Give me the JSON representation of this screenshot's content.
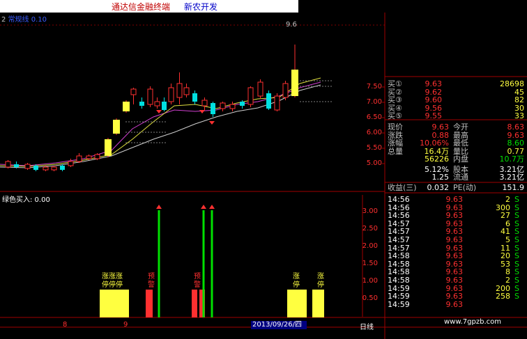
{
  "window": {
    "app_title": "通达信金融终端",
    "stock_name": "新农开发"
  },
  "price_chart": {
    "panel_index": "2",
    "indicator_name": "常规线",
    "indicator_value": "0.10",
    "high_marker": "9.6",
    "axis_ticks": [
      "7.50",
      "7.00",
      "6.50",
      "6.00",
      "5.50",
      "5.00"
    ]
  },
  "sub_chart": {
    "label": "绿色买入: 0.00",
    "axis_ticks": [
      "3.00",
      "2.50",
      "2.00",
      "1.50",
      "1.00",
      "0.50"
    ],
    "bar_labels": [
      {
        "text": "涨涨涨",
        "sub": "停停停"
      },
      {
        "text": "预",
        "sub": "警"
      },
      {
        "text": "预",
        "sub": "警"
      },
      {
        "text": "涨",
        "sub": "停"
      },
      {
        "text": "涨",
        "sub": "停"
      }
    ]
  },
  "bottom_bar": {
    "tick_a": "8",
    "tick_b": "9",
    "date": "2013/09/26/四",
    "period": "日线"
  },
  "order_book": [
    {
      "label": "买①",
      "price": "9.63",
      "vol": "28698"
    },
    {
      "label": "买②",
      "price": "9.62",
      "vol": "45"
    },
    {
      "label": "买③",
      "price": "9.60",
      "vol": "82"
    },
    {
      "label": "买④",
      "price": "9.56",
      "vol": "30"
    },
    {
      "label": "买⑤",
      "price": "9.55",
      "vol": "33"
    }
  ],
  "stats": [
    {
      "l1": "现价",
      "v1": "9.63",
      "l2": "今开",
      "v2": "8.63"
    },
    {
      "l1": "涨跌",
      "v1": "0.88",
      "l2": "最高",
      "v2": "9.63"
    },
    {
      "l1": "涨幅",
      "v1": "10.06%",
      "l2": "最低",
      "v2": "8.60"
    },
    {
      "l1": "总量",
      "v1": "16.4万",
      "l2": "量比",
      "v2": "0.77"
    },
    {
      "l1": "",
      "v1": "56226",
      "l2": "内盘",
      "v2": "10.7万"
    },
    {
      "l1": "",
      "v1": "5.12%",
      "l2": "股本",
      "v2": "3.21亿"
    },
    {
      "l1": "",
      "v1": "1.25",
      "l2": "流通",
      "v2": "3.21亿"
    },
    {
      "l1": "收益(三)",
      "v1": "0.032",
      "l2": "PE(动)",
      "v2": "151.9"
    }
  ],
  "ticks": [
    {
      "time": "14:56",
      "price": "9.63",
      "vol": "2",
      "side": "S"
    },
    {
      "time": "14:56",
      "price": "9.63",
      "vol": "300",
      "side": "S"
    },
    {
      "time": "14:56",
      "price": "9.63",
      "vol": "27",
      "side": "S"
    },
    {
      "time": "14:57",
      "price": "9.63",
      "vol": "6",
      "side": "S"
    },
    {
      "time": "14:57",
      "price": "9.63",
      "vol": "41",
      "side": "S"
    },
    {
      "time": "14:57",
      "price": "9.63",
      "vol": "5",
      "side": "S"
    },
    {
      "time": "14:57",
      "price": "9.63",
      "vol": "11",
      "side": "S"
    },
    {
      "time": "14:58",
      "price": "9.63",
      "vol": "20",
      "side": "S"
    },
    {
      "time": "14:58",
      "price": "9.63",
      "vol": "53",
      "side": "S"
    },
    {
      "time": "14:58",
      "price": "9.63",
      "vol": "8",
      "side": "S"
    },
    {
      "time": "14:58",
      "price": "9.63",
      "vol": "2",
      "side": "S"
    },
    {
      "time": "14:59",
      "price": "9.63",
      "vol": "200",
      "side": "S"
    },
    {
      "time": "14:59",
      "price": "9.63",
      "vol": "258",
      "side": "S"
    },
    {
      "time": "14:59",
      "price": "9.63",
      "vol": "",
      "side": ""
    }
  ],
  "watermark": "www.7gpzb.com",
  "colors": {
    "up": "#ff3030",
    "down": "#00e0e0",
    "yellow": "#ffff40",
    "green": "#00e000"
  }
}
